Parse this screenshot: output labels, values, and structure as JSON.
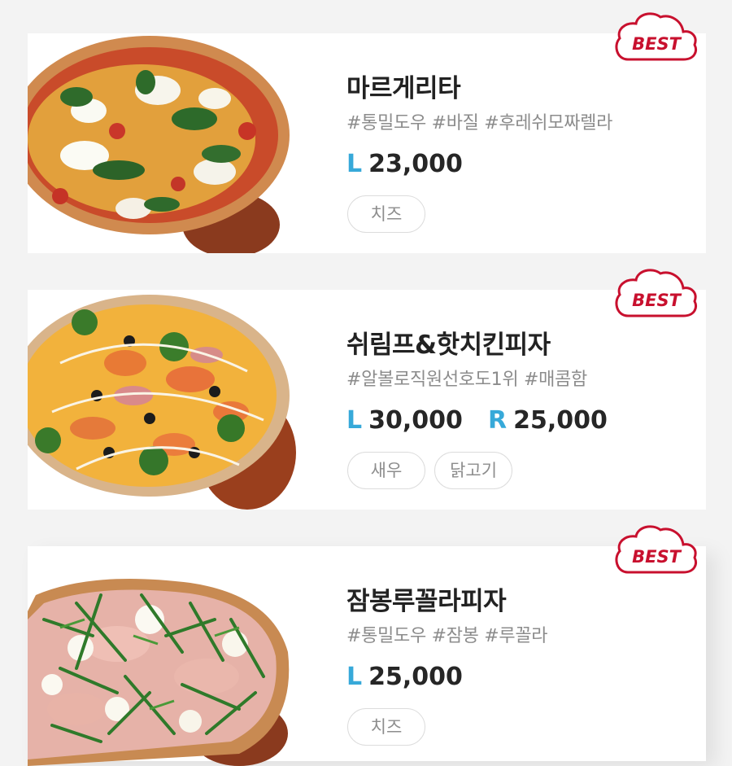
{
  "menu": [
    {
      "name": "마르게리타",
      "tags": "#통밀도우 #바질 #후레쉬모짜렐라",
      "prices": [
        {
          "size": "L",
          "amount": "23,000"
        }
      ],
      "chips": [
        "치즈"
      ],
      "badge": "BEST"
    },
    {
      "name": "쉬림프&핫치킨피자",
      "tags": "#알볼로직원선호도1위 #매콤함",
      "prices": [
        {
          "size": "L",
          "amount": "30,000"
        },
        {
          "size": "R",
          "amount": "25,000"
        }
      ],
      "chips": [
        "새우",
        "닭고기"
      ],
      "badge": "BEST"
    },
    {
      "name": "잠봉루꼴라피자",
      "tags": "#통밀도우 #잠봉 #루꼴라",
      "prices": [
        {
          "size": "L",
          "amount": "25,000"
        }
      ],
      "chips": [
        "치즈"
      ],
      "badge": "BEST"
    }
  ],
  "colors": {
    "size_accent": "#37a9d9",
    "badge_red": "#c8102e",
    "background": "#f3f3f3"
  }
}
